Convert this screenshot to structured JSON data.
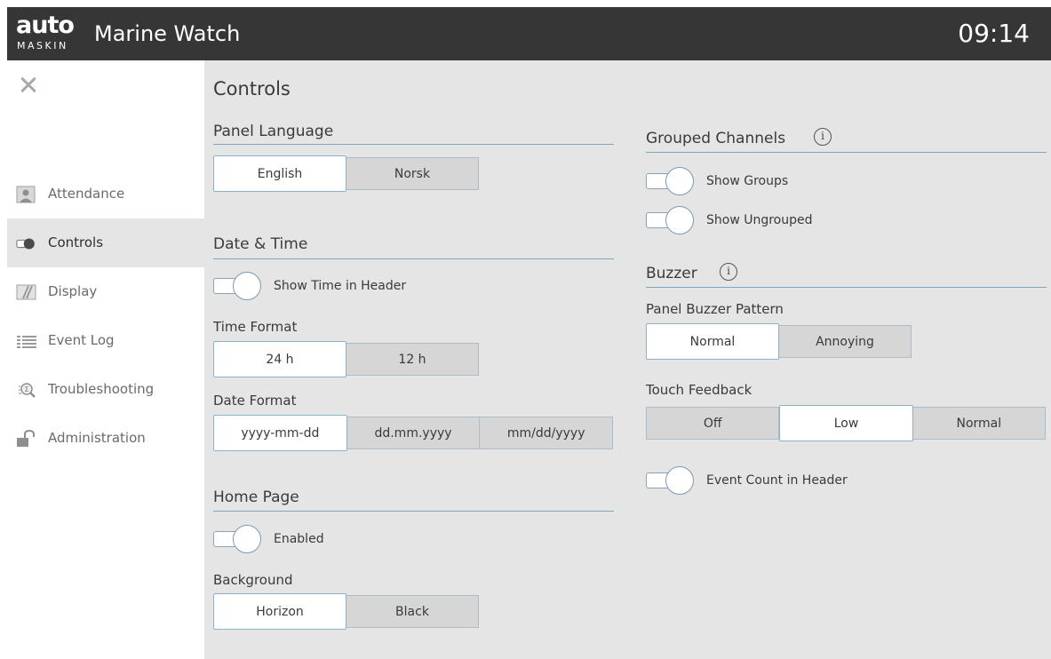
{
  "header": {
    "logo_main": "auto",
    "logo_sub": "MASKIN",
    "app_title": "Marine Watch",
    "time": "09:14"
  },
  "sidebar": {
    "close_icon": "close-icon",
    "items": [
      {
        "label": "Attendance",
        "icon": "person-icon",
        "active": false
      },
      {
        "label": "Controls",
        "icon": "toggle-icon",
        "active": true
      },
      {
        "label": "Display",
        "icon": "display-icon",
        "active": false
      },
      {
        "label": "Event Log",
        "icon": "list-icon",
        "active": false
      },
      {
        "label": "Troubleshooting",
        "icon": "magnifier-icon",
        "active": false
      },
      {
        "label": "Administration",
        "icon": "padlock-icon",
        "active": false
      }
    ]
  },
  "main": {
    "title": "Controls",
    "panel_language": {
      "title": "Panel Language",
      "options": [
        "English",
        "Norsk"
      ],
      "selected": "English"
    },
    "date_time": {
      "title": "Date & Time",
      "show_time_toggle": {
        "label": "Show Time in Header",
        "on": true
      },
      "time_format": {
        "label": "Time Format",
        "options": [
          "24 h",
          "12 h"
        ],
        "selected": "24 h"
      },
      "date_format": {
        "label": "Date Format",
        "options": [
          "yyyy-mm-dd",
          "dd.mm.yyyy",
          "mm/dd/yyyy"
        ],
        "selected": "yyyy-mm-dd"
      }
    },
    "home_page": {
      "title": "Home Page",
      "enabled_toggle": {
        "label": "Enabled",
        "on": true
      },
      "background": {
        "label": "Background",
        "options": [
          "Horizon",
          "Black"
        ],
        "selected": "Horizon"
      }
    },
    "grouped_channels": {
      "title": "Grouped Channels",
      "info_icon": "info-icon",
      "show_groups_toggle": {
        "label": "Show Groups",
        "on": true
      },
      "show_ungrouped_toggle": {
        "label": "Show Ungrouped",
        "on": true
      }
    },
    "buzzer": {
      "title": "Buzzer",
      "info_icon": "info-icon",
      "pattern": {
        "label": "Panel Buzzer Pattern",
        "options": [
          "Normal",
          "Annoying"
        ],
        "selected": "Normal"
      },
      "touch_feedback": {
        "label": "Touch Feedback",
        "options": [
          "Off",
          "Low",
          "Normal"
        ],
        "selected": "Low"
      },
      "event_count_toggle": {
        "label": "Event Count in Header",
        "on": true
      }
    }
  },
  "colors": {
    "header_bg": "#363636",
    "content_bg": "#e5e5e5",
    "sidebar_bg": "#ffffff",
    "accent_rule": "#7fa6c0",
    "segment_unselected": "#d6d6d6",
    "segment_selected": "#ffffff"
  }
}
